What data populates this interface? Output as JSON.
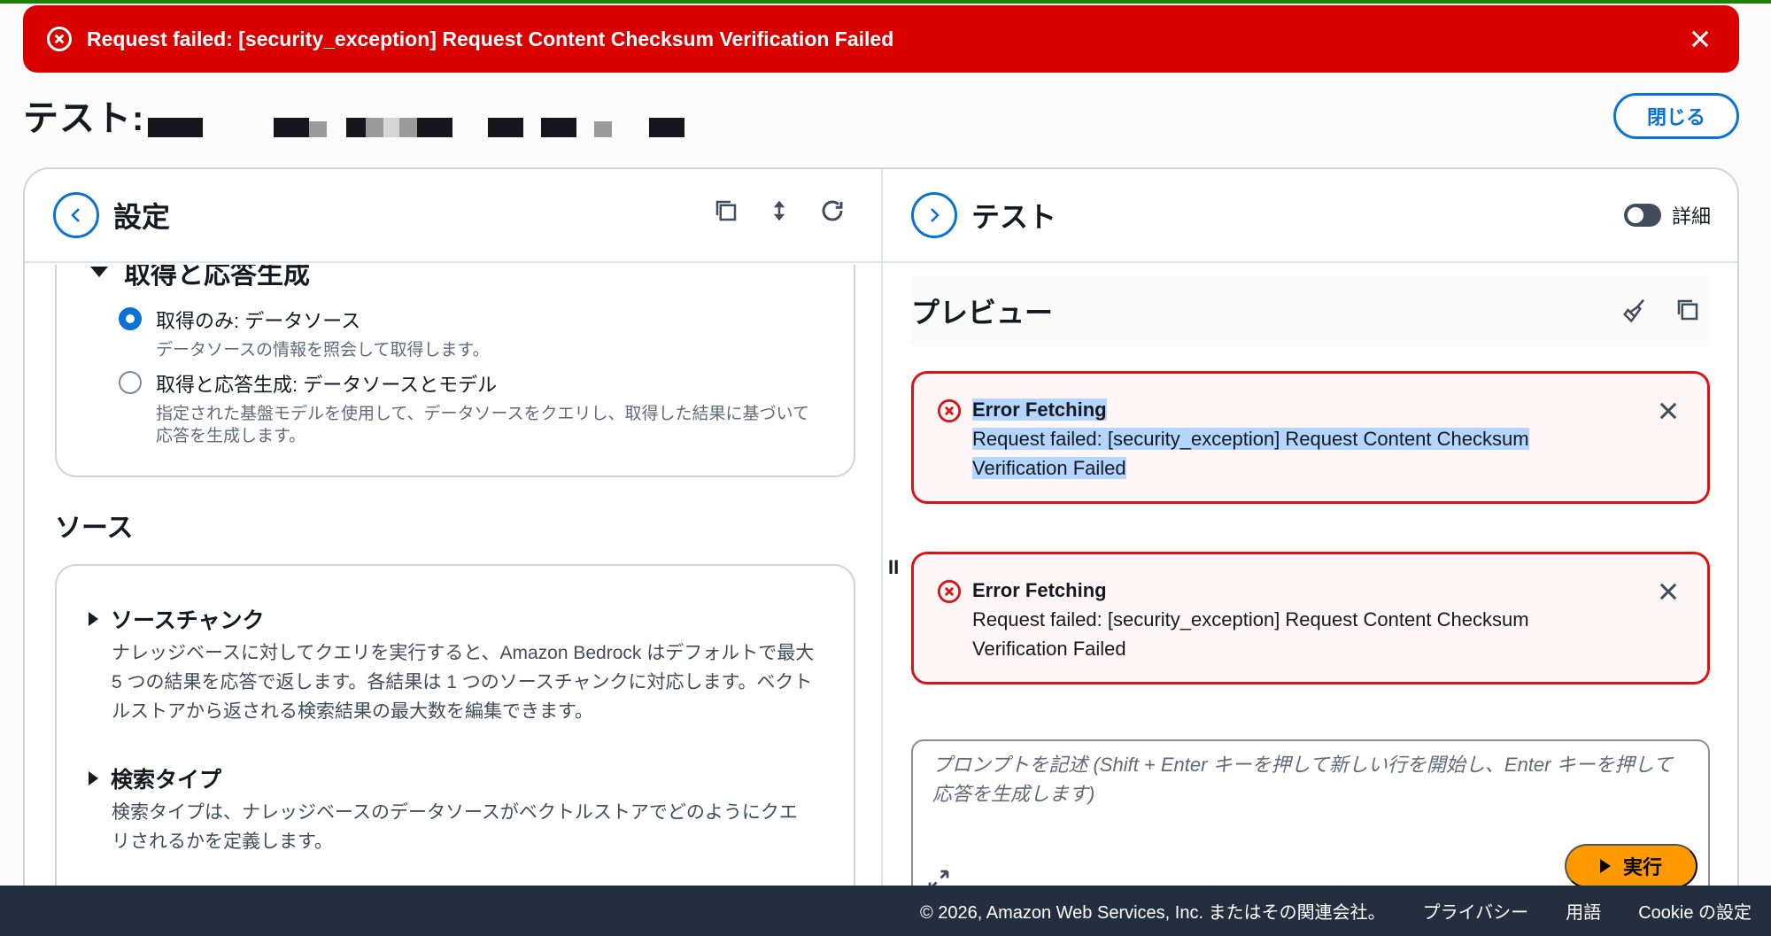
{
  "flash": {
    "message": "Request failed: [security_exception] Request Content Checksum Verification Failed",
    "color": "#d90000"
  },
  "page": {
    "title": "テスト:",
    "close_label": "閉じる"
  },
  "left_panel": {
    "title": "設定",
    "tools": [
      "copy-icon",
      "expand-collapse-icon",
      "refresh-icon"
    ],
    "section_title": "取得と応答生成",
    "options": [
      {
        "label": "取得のみ: データソース",
        "desc": "データソースの情報を照会して取得します。",
        "selected": true
      },
      {
        "label": "取得と応答生成: データソースとモデル",
        "desc": "指定された基盤モデルを使用して、データソースをクエリし、取得した結果に基づいて応答を生成します。",
        "selected": false
      }
    ],
    "sources_title": "ソース",
    "expandables": [
      {
        "title": "ソースチャンク",
        "desc": "ナレッジベースに対してクエリを実行すると、Amazon Bedrock はデフォルトで最大 5 つの結果を応答で返します。各結果は 1 つのソースチャンクに対応します。ベクトルストアから返される検索結果の最大数を編集できます。"
      },
      {
        "title": "検索タイプ",
        "desc": "検索タイプは、ナレッジベースのデータソースがベクトルストアでどのようにクエリされるかを定義します。"
      }
    ]
  },
  "right_panel": {
    "title": "テスト",
    "toggle_label": "詳細",
    "preview_title": "プレビュー",
    "errors": [
      {
        "title": "Error Fetching",
        "message": "Request failed: [security_exception] Request Content Checksum Verification Failed"
      },
      {
        "title": "Error Fetching",
        "message": "Request failed: [security_exception] Request Content Checksum Verification Failed"
      }
    ],
    "prompt_placeholder": "プロンプトを記述 (Shift + Enter キーを押して新しい行を開始し、Enter キーを押して応答を生成します)",
    "run_label": "実行",
    "drag_handle": "II"
  },
  "footer": {
    "copyright": "© 2026, Amazon Web Services, Inc. またはその関連会社。",
    "privacy": "プライバシー",
    "terms": "用語",
    "cookies": "Cookie の設定"
  },
  "colors": {
    "accent": "#0972d3",
    "error": "#d91515",
    "run_button": "#ff9900",
    "footer_bg": "#232f3e"
  }
}
